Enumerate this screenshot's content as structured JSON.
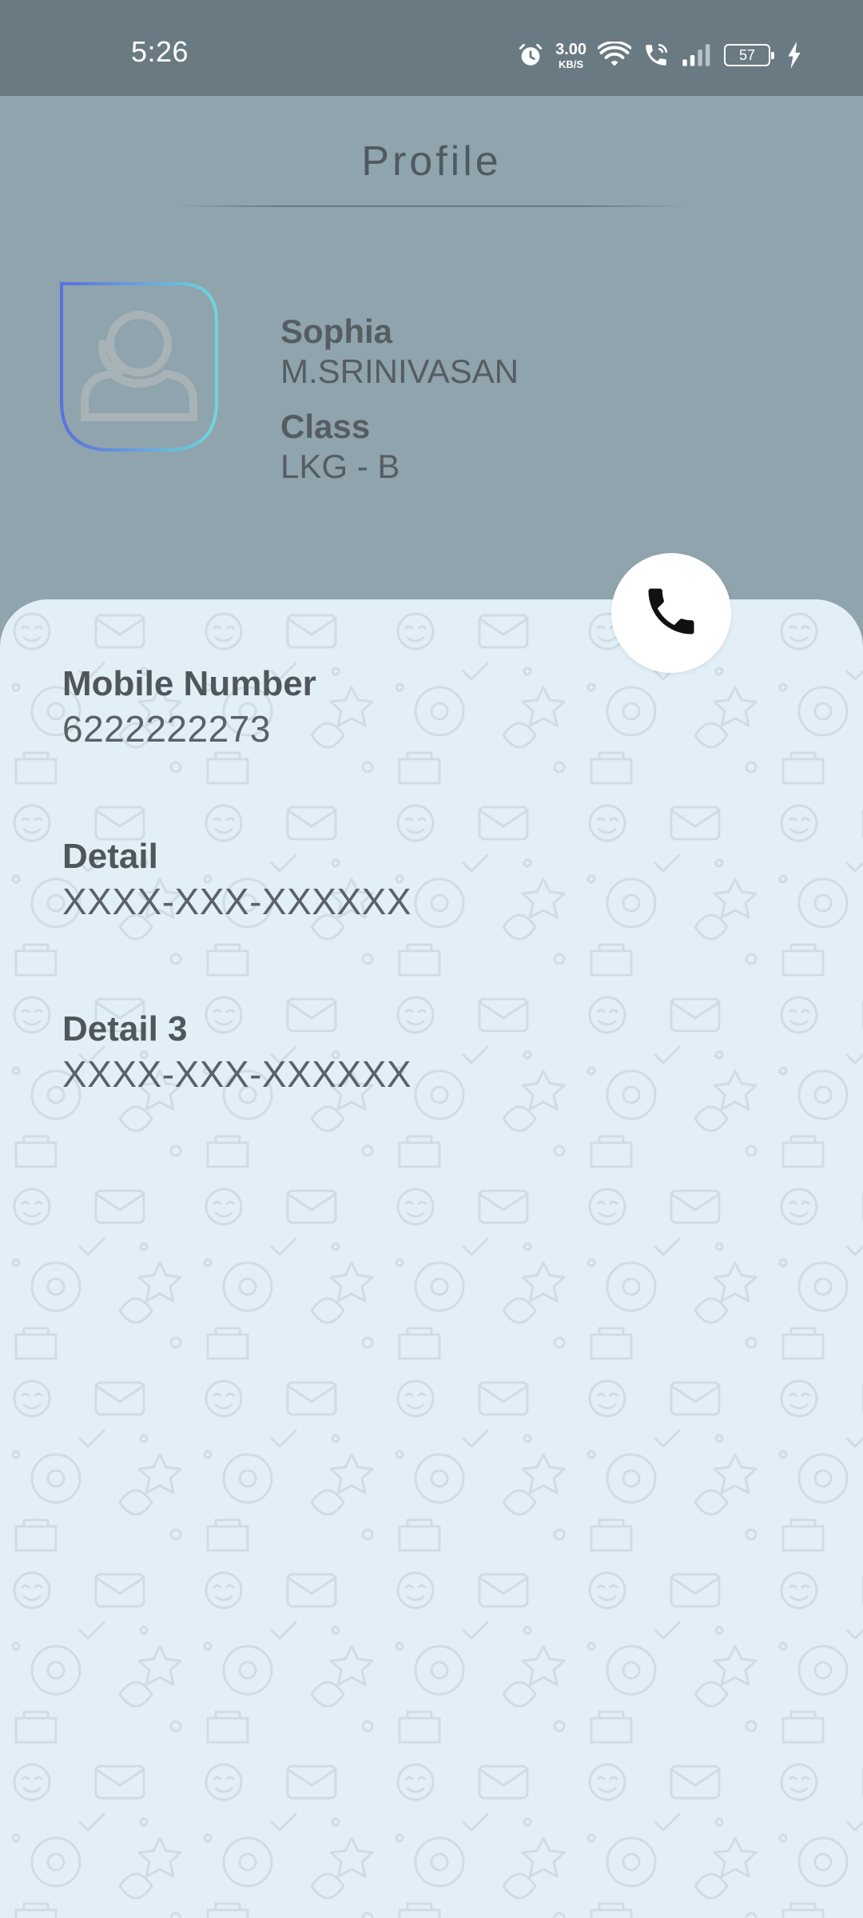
{
  "status_bar": {
    "time": "5:26",
    "net_speed_value": "3.00",
    "net_speed_unit": "KB/S",
    "battery_level": "57",
    "icons": [
      "alarm-icon",
      "wifi-icon",
      "wifi-calling-icon",
      "signal-icon",
      "battery-icon",
      "charging-icon"
    ]
  },
  "header": {
    "title": "Profile"
  },
  "profile": {
    "name": "Sophia",
    "parent_name": "M.SRINIVASAN",
    "class_label": "Class",
    "class_value": "LKG - B",
    "avatar_icon": "user-placeholder-icon"
  },
  "call_button": {
    "icon": "phone-icon"
  },
  "details": [
    {
      "label": "Mobile Number",
      "value": "6222222273"
    },
    {
      "label": "Detail",
      "value": "XXXX-XXX-XXXXXX"
    },
    {
      "label": "Detail 3",
      "value": "XXXX-XXX-XXXXXX"
    }
  ],
  "colors": {
    "status_bar": "#6a7a82",
    "header_bg": "#8fa4ad",
    "card_bg": "#e3eff7",
    "text_dark": "#4f575c",
    "avatar_gradient_start": "#5b6fe0",
    "avatar_gradient_end": "#6fd6dc"
  }
}
